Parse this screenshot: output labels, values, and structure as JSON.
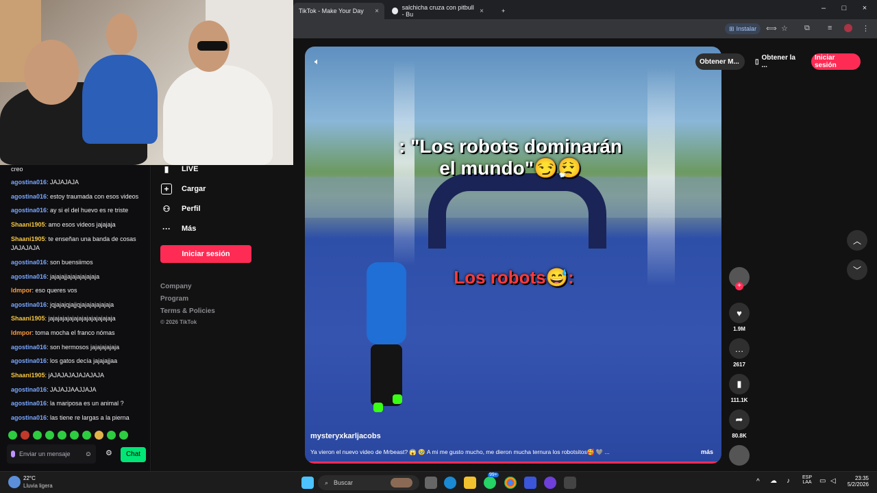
{
  "browser": {
    "tabs": [
      {
        "title": "TikTok - Make Your Day",
        "close": "×"
      },
      {
        "title": "salchicha cruza con pitbull - Bu",
        "close": "×"
      }
    ],
    "new_tab": "+",
    "install_label": "Instalar",
    "window_controls": [
      "–",
      "□",
      "×"
    ]
  },
  "chat": {
    "first_line": "creo",
    "messages": [
      {
        "user": "agostina016",
        "text": ": JAJAJAJA",
        "color": "#7aa7ff"
      },
      {
        "user": "agostina016",
        "text": ": estoy traumada con esos videos",
        "color": "#7aa7ff"
      },
      {
        "user": "agostina016",
        "text": ": ay si el del huevo es re triste",
        "color": "#7aa7ff"
      },
      {
        "user": "Shaani1905",
        "text": ": amo esos videos jajajaja",
        "color": "#f5c542"
      },
      {
        "user": "Shaani1905",
        "text": ": te enseñan una banda de cosas JAJAJAJA",
        "color": "#f5c542"
      },
      {
        "user": "agostina016",
        "text": ": son buensiimos",
        "color": "#7aa7ff"
      },
      {
        "user": "agostina016",
        "text": ": jajajajjajajajajajaja",
        "color": "#7aa7ff"
      },
      {
        "user": "ldmpor",
        "text": ": eso queres vos",
        "color": "#ff9b3d"
      },
      {
        "user": "agostina016",
        "text": ": jqjajajqjajjqjajajajajajaja",
        "color": "#7aa7ff"
      },
      {
        "user": "Shaani1905",
        "text": ": jajajajajajajajajajajajajaja",
        "color": "#f5c542"
      },
      {
        "user": "ldmpor",
        "text": ": toma mocha el franco nómas",
        "color": "#ff9b3d"
      },
      {
        "user": "agostina016",
        "text": ": son hermosos jajajajajaja",
        "color": "#7aa7ff"
      },
      {
        "user": "agostina016",
        "text": ": los gatos decía jajajajjaa",
        "color": "#7aa7ff"
      },
      {
        "user": "Shaani1905",
        "text": ": jAJAJAJAJAJAJAJA",
        "color": "#f5c542"
      },
      {
        "user": "agostina016",
        "text": ": JAJAJJAAJJAJA",
        "color": "#7aa7ff"
      },
      {
        "user": "agostina016",
        "text": ": la mariposa es un animal ?",
        "color": "#7aa7ff"
      },
      {
        "user": "agostina016",
        "text": ": las tiene re largas a la pierna",
        "color": "#7aa7ff"
      }
    ],
    "input_placeholder": "Enviar un mensaje",
    "send_label": "Chat"
  },
  "tiktok": {
    "nav": [
      {
        "label": "LIVE",
        "icon": "live-icon"
      },
      {
        "label": "Cargar",
        "icon": "upload-icon"
      },
      {
        "label": "Perfil",
        "icon": "profile-icon"
      },
      {
        "label": "Más",
        "icon": "more-icon"
      }
    ],
    "login_button": "Iniciar sesión",
    "footer": [
      "Company",
      "Program",
      "Terms & Policies",
      "© 2026 TikTok"
    ],
    "top_actions": [
      "Obtener M...",
      "Obtener la ...",
      "Iniciar sesión"
    ],
    "video": {
      "caption_top_line1": ": \"Los robots dominarán",
      "caption_top_line2": "el mundo\"😏😮‍💨",
      "caption_mid": "Los robots😅:",
      "author": "mysteryxkarljacobs",
      "description": "Ya vieron el nuevo video de Mrbeast? 😱 🥹 A mi me gusto mucho, me dieron mucha ternura los robotsitos🥰 🩶 ...",
      "more": "más"
    },
    "stats": {
      "likes": "1.9M",
      "comments": "2617",
      "saves": "111.1K",
      "shares": "80.8K"
    }
  },
  "taskbar": {
    "weather_temp": "22°C",
    "weather_desc": "Lluvia ligera",
    "search": "Buscar",
    "badge": "99+",
    "lang_top": "ESP",
    "lang_bottom": "LAA",
    "time": "23:35",
    "date": "5/2/2026"
  }
}
